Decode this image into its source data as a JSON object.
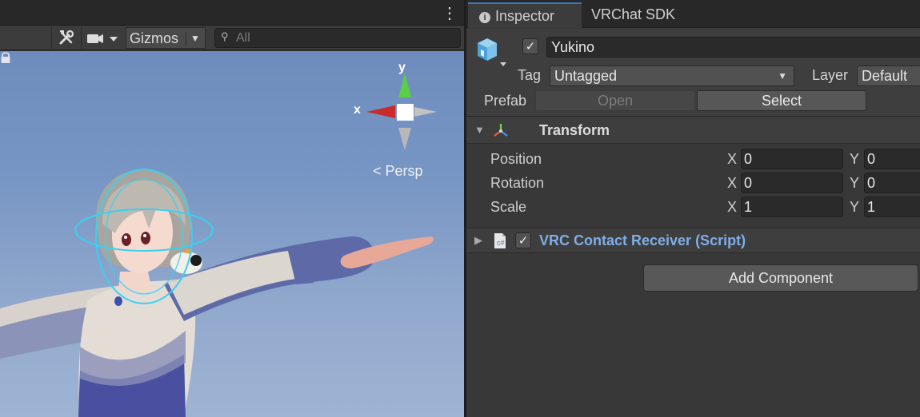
{
  "scene": {
    "toolbar": {
      "gizmos_label": "Gizmos",
      "search_placeholder": "All"
    },
    "gizmo": {
      "x_label": "x",
      "y_label": "y"
    },
    "persp_label": "Persp"
  },
  "inspector": {
    "tabs": [
      {
        "label": "Inspector",
        "active": true
      },
      {
        "label": "VRChat SDK",
        "active": false
      }
    ],
    "object": {
      "active": true,
      "name": "Yukino",
      "tag_label": "Tag",
      "tag_value": "Untagged",
      "layer_label": "Layer",
      "layer_value": "Default",
      "prefab_label": "Prefab",
      "prefab_open": "Open",
      "prefab_select": "Select"
    },
    "transform": {
      "title": "Transform",
      "rows": [
        {
          "label": "Position",
          "x": "0",
          "y": "0"
        },
        {
          "label": "Rotation",
          "x": "0",
          "y": "0"
        },
        {
          "label": "Scale",
          "x": "1",
          "y": "1"
        }
      ],
      "axis_x": "X",
      "axis_y": "Y"
    },
    "components": [
      {
        "title": "VRC Contact Receiver (Script)",
        "enabled": true
      }
    ],
    "add_component": "Add Component"
  },
  "colors": {
    "accent_tab": "#3a79bb",
    "script_title": "#7eaee8",
    "sky_top": "#6d8cbd",
    "sky_bottom": "#9fb4d3"
  }
}
